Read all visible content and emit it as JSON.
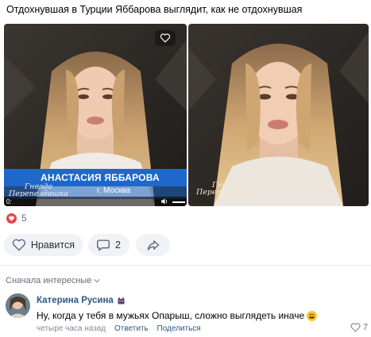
{
  "post": {
    "text": "Отдохнувшая в Турции Яббарова выглядит, как не отдохнувшая"
  },
  "media": {
    "left": {
      "banner_name": "АНАСТАСИЯ ЯББАРОВА",
      "banner_city": "г. Москва",
      "show_logo_line1": "Гнездо",
      "show_logo_line2": "Перепелёвшка",
      "video_time": "0:"
    },
    "right": {
      "show_logo_line1": "Гнездо",
      "show_logo_line2": "Перепелёвшка"
    },
    "icons": {
      "favorite": "heart-outline-icon",
      "volume": "volume-icon"
    }
  },
  "reactions": {
    "likes_count": "5",
    "icon": "heart-filled-icon",
    "color": "#e64646"
  },
  "actions": {
    "like_label": "Нравится",
    "comment_count": "2",
    "share_icon": "share-arrow-icon"
  },
  "comments": {
    "sort_label": "Сначала интересные",
    "items": [
      {
        "author": "Катерина Русина",
        "text": "Ну, когда у тебя в мужьях Опарыш, сложно выглядеть иначе",
        "time": "четыре часа назад",
        "reply_label": "Ответить",
        "share_label": "Поделиться",
        "likes": "7"
      }
    ]
  },
  "colors": {
    "link": "#2a5885",
    "secondary": "#626d7a",
    "button_bg": "#f0f2f5",
    "banner_blue": "#1f67c9"
  }
}
